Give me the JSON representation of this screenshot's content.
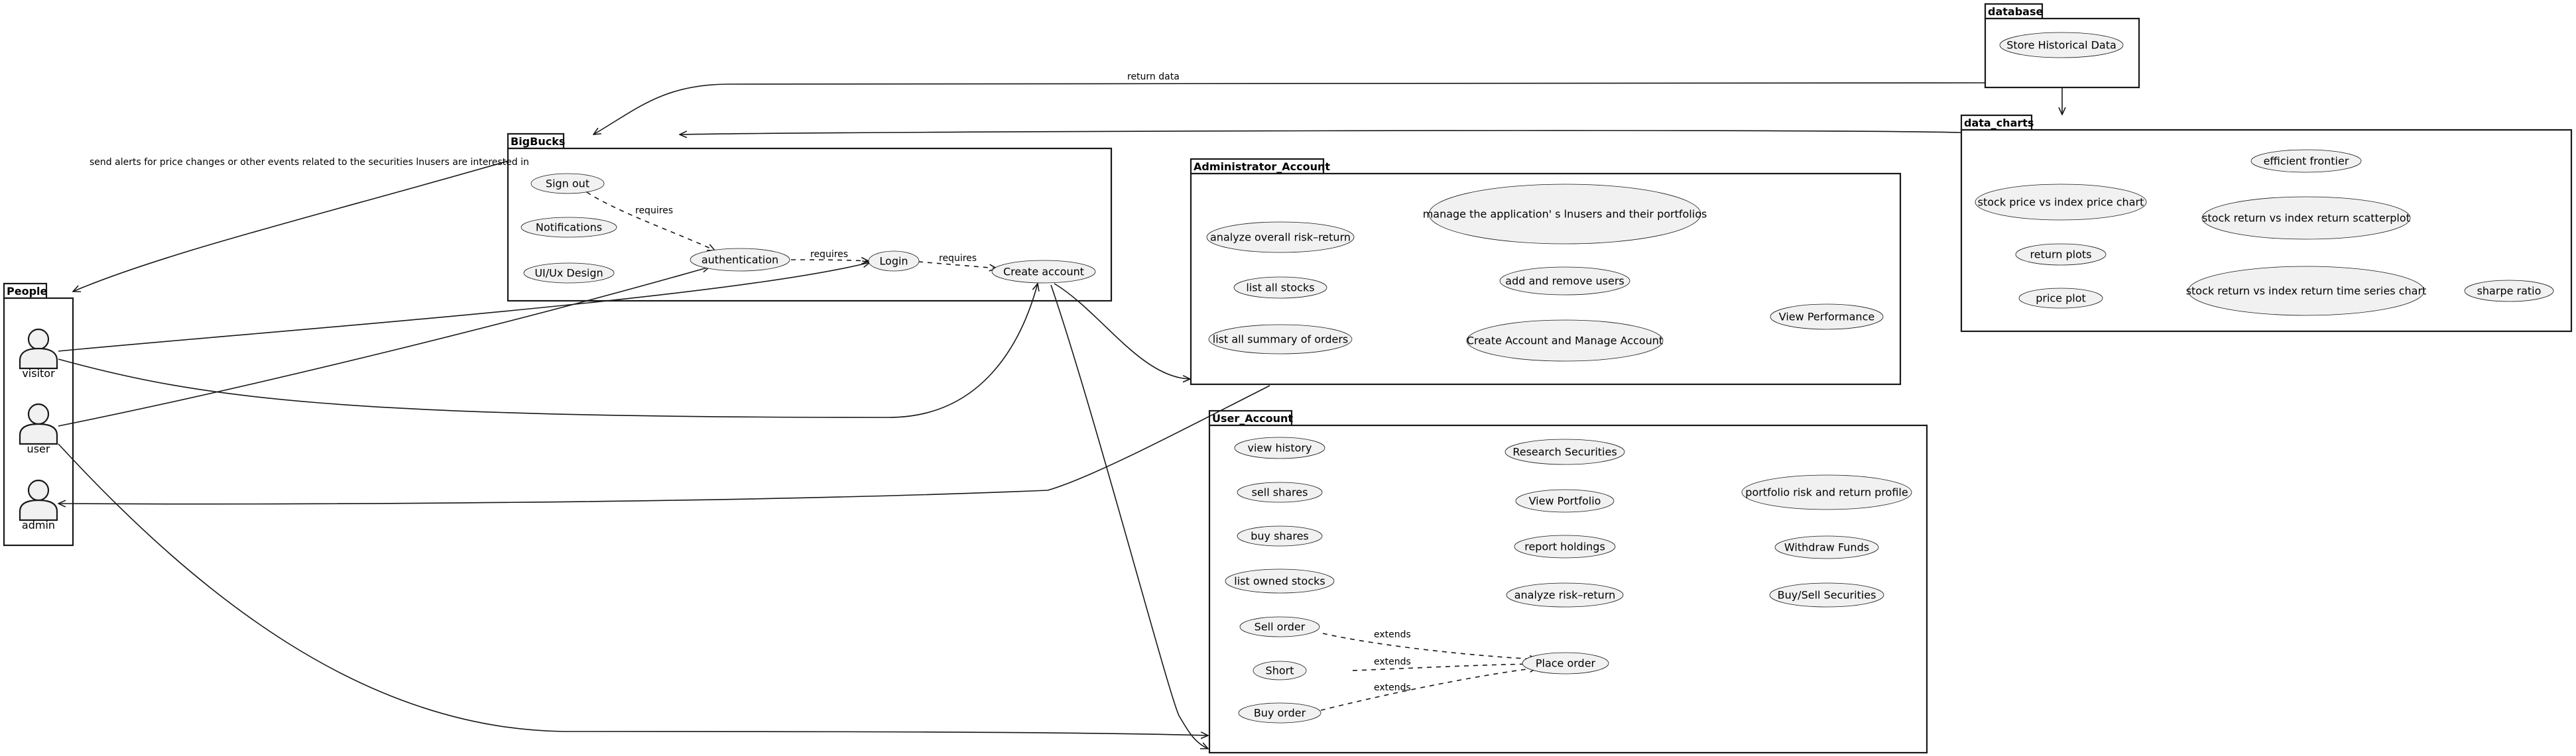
{
  "packages": {
    "people": "People",
    "bigbucks": "BigBucks",
    "admin_account": "Administrator_Account",
    "user_account": "User_Account",
    "database": "database",
    "data_charts": "data_charts"
  },
  "actors": {
    "visitor": "visitor",
    "user": "user",
    "admin": "admin"
  },
  "use_cases": {
    "sign_out": "Sign out",
    "notifications": "Notifications",
    "ui_ux_design": "UI/Ux Design",
    "authentication": "authentication",
    "login": "Login",
    "create_account": "Create account",
    "analyze_overall": "analyze overall risk–return",
    "list_all_stocks": "list all stocks",
    "list_all_summary": "list all summary of orders",
    "manage_users": "manage the application' s lnusers and their portfolios",
    "add_remove_users": "add and remove users",
    "create_manage_account": "Create Account and Manage Account",
    "view_performance": "View Performance",
    "view_history": "view history",
    "sell_shares": "sell shares",
    "buy_shares": "buy shares",
    "list_owned_stocks": "list owned stocks",
    "sell_order": "Sell order",
    "short": "Short",
    "buy_order": "Buy order",
    "research_securities": "Research Securities",
    "view_portfolio": "View Portfolio",
    "report_holdings": "report holdings",
    "analyze_risk_return": "analyze risk–return",
    "place_order": "Place order",
    "portfolio_profile": "portfolio risk and return profile",
    "withdraw_funds": "Withdraw Funds",
    "buy_sell_securities": "Buy/Sell Securities",
    "store_historical": "Store Historical Data",
    "efficient_frontier": "efficient frontier",
    "stock_price_vs_index": "stock price vs index price chart",
    "stock_return_scatter": "stock return vs index return scatterplot",
    "return_plots": "return plots",
    "price_plot": "price plot",
    "stock_return_timeseries": "stock return vs index return  time series chart",
    "sharpe_ratio": "sharpe ratio"
  },
  "edge_labels": {
    "requires_1": "requires",
    "requires_2": "requires",
    "requires_3": "requires",
    "extends_1": "extends",
    "extends_2": "extends",
    "extends_3": "extends",
    "return_data": "return data",
    "send_alerts": "send alerts for price changes or other events related to the securities lnusers are interested in"
  }
}
